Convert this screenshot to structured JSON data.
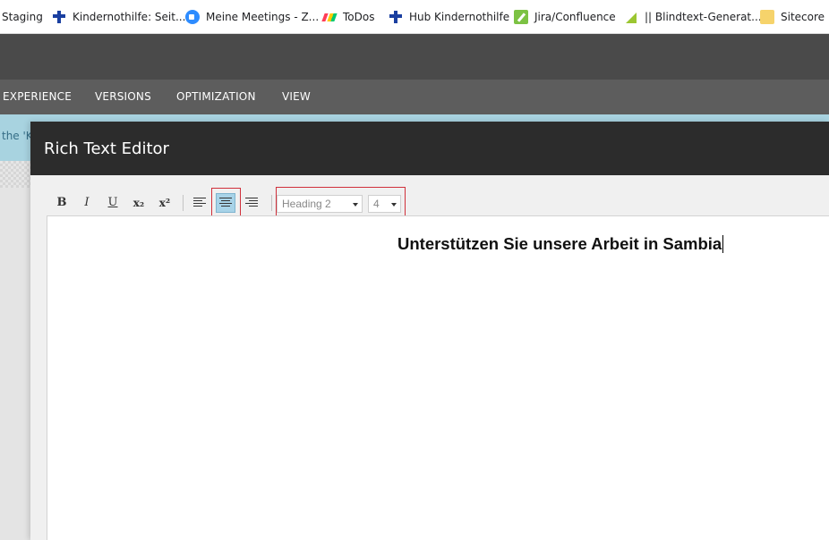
{
  "bookmarks": [
    {
      "label": "Staging",
      "icon": "none"
    },
    {
      "label": "Kindernothilfe: Seit...",
      "icon": "cross-icon"
    },
    {
      "label": "Meine Meetings - Z...",
      "icon": "zoom-icon"
    },
    {
      "label": "ToDos",
      "icon": "monday-icon"
    },
    {
      "label": "Hub Kindernothilfe",
      "icon": "cross-icon"
    },
    {
      "label": "Jira/Confluence",
      "icon": "jira-icon"
    },
    {
      "label": "|| Blindtext-Generat...",
      "icon": "blindtext-icon"
    },
    {
      "label": "Sitecore Fr",
      "icon": "folder-icon"
    }
  ],
  "nav": {
    "items": [
      "EXPERIENCE",
      "VERSIONS",
      "OPTIMIZATION",
      "VIEW"
    ]
  },
  "infobar": {
    "text": "the 'K"
  },
  "dialog": {
    "title": "Rich Text Editor",
    "toolbar": {
      "bold": "B",
      "italic": "I",
      "underline": "U",
      "subscript": "x₂",
      "superscript": "x²",
      "format_value": "Heading 2",
      "size_value": "4"
    },
    "editor": {
      "content": "Unterstützen Sie unsere Arbeit in Sambia"
    }
  },
  "colors": {
    "highlight": "#d0303b",
    "active_button": "#a8d3e8",
    "dialog_header": "#2c2c2c"
  }
}
